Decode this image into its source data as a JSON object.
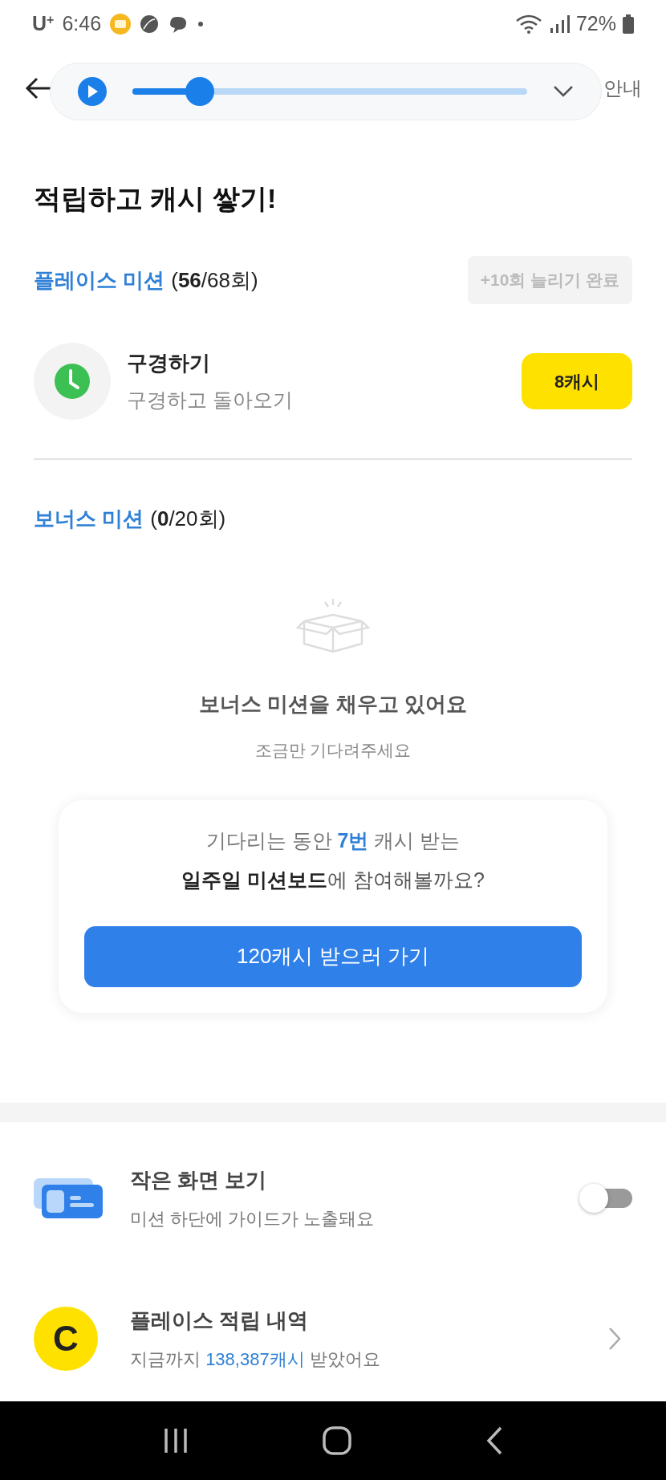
{
  "status_bar": {
    "carrier": "U$^{+}$",
    "time": "6:46",
    "battery": "72%"
  },
  "player": {
    "playing": false,
    "level": 0.17
  },
  "header": {
    "guide": "안내"
  },
  "headline": "적립하고 캐시 쌓기!",
  "place_mission": {
    "title": "플레이스 미션",
    "count": "(**56**/68회)",
    "extend_button": {
      "label": "+10회 늘리기 완료",
      "disabled": true
    },
    "items": [
      {
        "title": "구경하기",
        "subtitle": "구경하고 돌아오기",
        "reward": "8캐시"
      }
    ]
  },
  "bonus_mission": {
    "title": "보너스 미션",
    "count": "(**0**/20회)",
    "empty_title": "보너스 미션을 채우고 있어요",
    "empty_subtitle": "조금만 기다려주세요",
    "promo": {
      "line1": "기다리는 동안 **7번** 캐시 받는",
      "line2": "**일주일 미션보드**에 참여해볼까요?",
      "button": "120캐시 받으러 가기"
    }
  },
  "settings": [
    {
      "kind": "toggle",
      "title": "작은 화면 보기",
      "subtitle": "미션 하단에 가이드가 노출돼요",
      "on": false
    },
    {
      "kind": "link",
      "title": "플레이스 적립 내역",
      "subtitle": "지금까지 *138,387캐시* 받았어요",
      "logo": "C"
    }
  ]
}
